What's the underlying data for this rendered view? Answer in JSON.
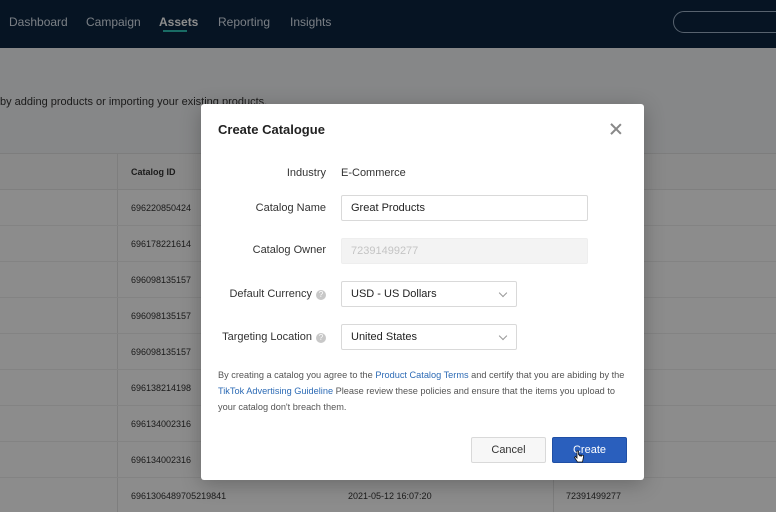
{
  "nav": {
    "items": [
      {
        "label": "Dashboard"
      },
      {
        "label": "Campaign"
      },
      {
        "label": "Assets"
      },
      {
        "label": "Reporting"
      },
      {
        "label": "Insights"
      }
    ],
    "active": "Assets"
  },
  "background": {
    "subtitle": "by adding products or importing your existing products.",
    "table": {
      "column_header": "Catalog ID",
      "rows": [
        {
          "id": "696220850424",
          "date": "",
          "owner": ""
        },
        {
          "id": "696178221614",
          "date": "",
          "owner": ""
        },
        {
          "id": "696098135157",
          "date": "",
          "owner": ""
        },
        {
          "id": "696098135157",
          "date": "",
          "owner": ""
        },
        {
          "id": "696098135157",
          "date": "",
          "owner": ""
        },
        {
          "id": "696138214198",
          "date": "",
          "owner": ""
        },
        {
          "id": "696134002316",
          "date": "",
          "owner": ""
        },
        {
          "id": "696134002316",
          "date": "",
          "owner": ""
        },
        {
          "id": "6961306489705219841",
          "date": "2021-05-12 16:07:20",
          "owner": "72391499277"
        }
      ]
    }
  },
  "modal": {
    "title": "Create Catalogue",
    "fields": {
      "industry": {
        "label": "Industry",
        "value": "E-Commerce"
      },
      "catalog_name": {
        "label": "Catalog Name",
        "value": "Great Products"
      },
      "catalog_owner": {
        "label": "Catalog Owner",
        "value": "72391499277"
      },
      "default_currency": {
        "label": "Default Currency",
        "value": "USD - US Dollars",
        "help": "?"
      },
      "targeting_location": {
        "label": "Targeting Location",
        "value": "United States",
        "help": "?"
      }
    },
    "terms": {
      "text_1": "By creating a catalog you agree to the ",
      "link_1": "Product Catalog Terms",
      "text_2": " and certify that you are abiding by the ",
      "link_2": "TikTok Advertising Guideline",
      "text_3": " Please review these policies and ensure that the items you upload to your catalog don't breach them."
    },
    "buttons": {
      "cancel": "Cancel",
      "create": "Create"
    }
  },
  "colors": {
    "nav_bg": "#0b2540",
    "accent": "#2ec4b6",
    "primary_button": "#2a5fbd",
    "link": "#2d6bb5"
  }
}
